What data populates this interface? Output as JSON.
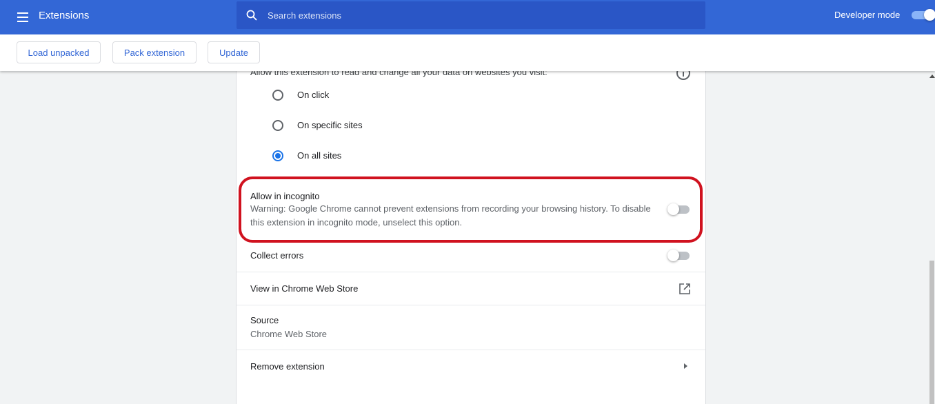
{
  "header": {
    "title": "Extensions",
    "search_placeholder": "Search extensions",
    "developer_mode_label": "Developer mode",
    "developer_mode_on": true
  },
  "toolbar": {
    "load_unpacked": "Load unpacked",
    "pack_extension": "Pack extension",
    "update": "Update"
  },
  "site_access": {
    "question": "Allow this extension to read and change all your data on websites you visit:",
    "options": [
      {
        "label": "On click",
        "selected": false
      },
      {
        "label": "On specific sites",
        "selected": false
      },
      {
        "label": "On all sites",
        "selected": true
      }
    ]
  },
  "incognito": {
    "title": "Allow in incognito",
    "warning_line1": "Warning: Google Chrome cannot prevent extensions from recording your browsing history. To disable",
    "warning_line2": "this extension in incognito mode, unselect this option.",
    "enabled": false
  },
  "collect_errors": {
    "title": "Collect errors",
    "enabled": false
  },
  "web_store": {
    "title": "View in Chrome Web Store"
  },
  "source": {
    "title": "Source",
    "value": "Chrome Web Store"
  },
  "remove": {
    "title": "Remove extension"
  },
  "colors": {
    "header_blue": "#3367d6",
    "accent_blue": "#1a73e8",
    "highlight_red": "#d0121f"
  },
  "icons": [
    "menu-icon",
    "search-icon",
    "info-icon",
    "open-in-new-icon",
    "chevron-right-icon"
  ]
}
